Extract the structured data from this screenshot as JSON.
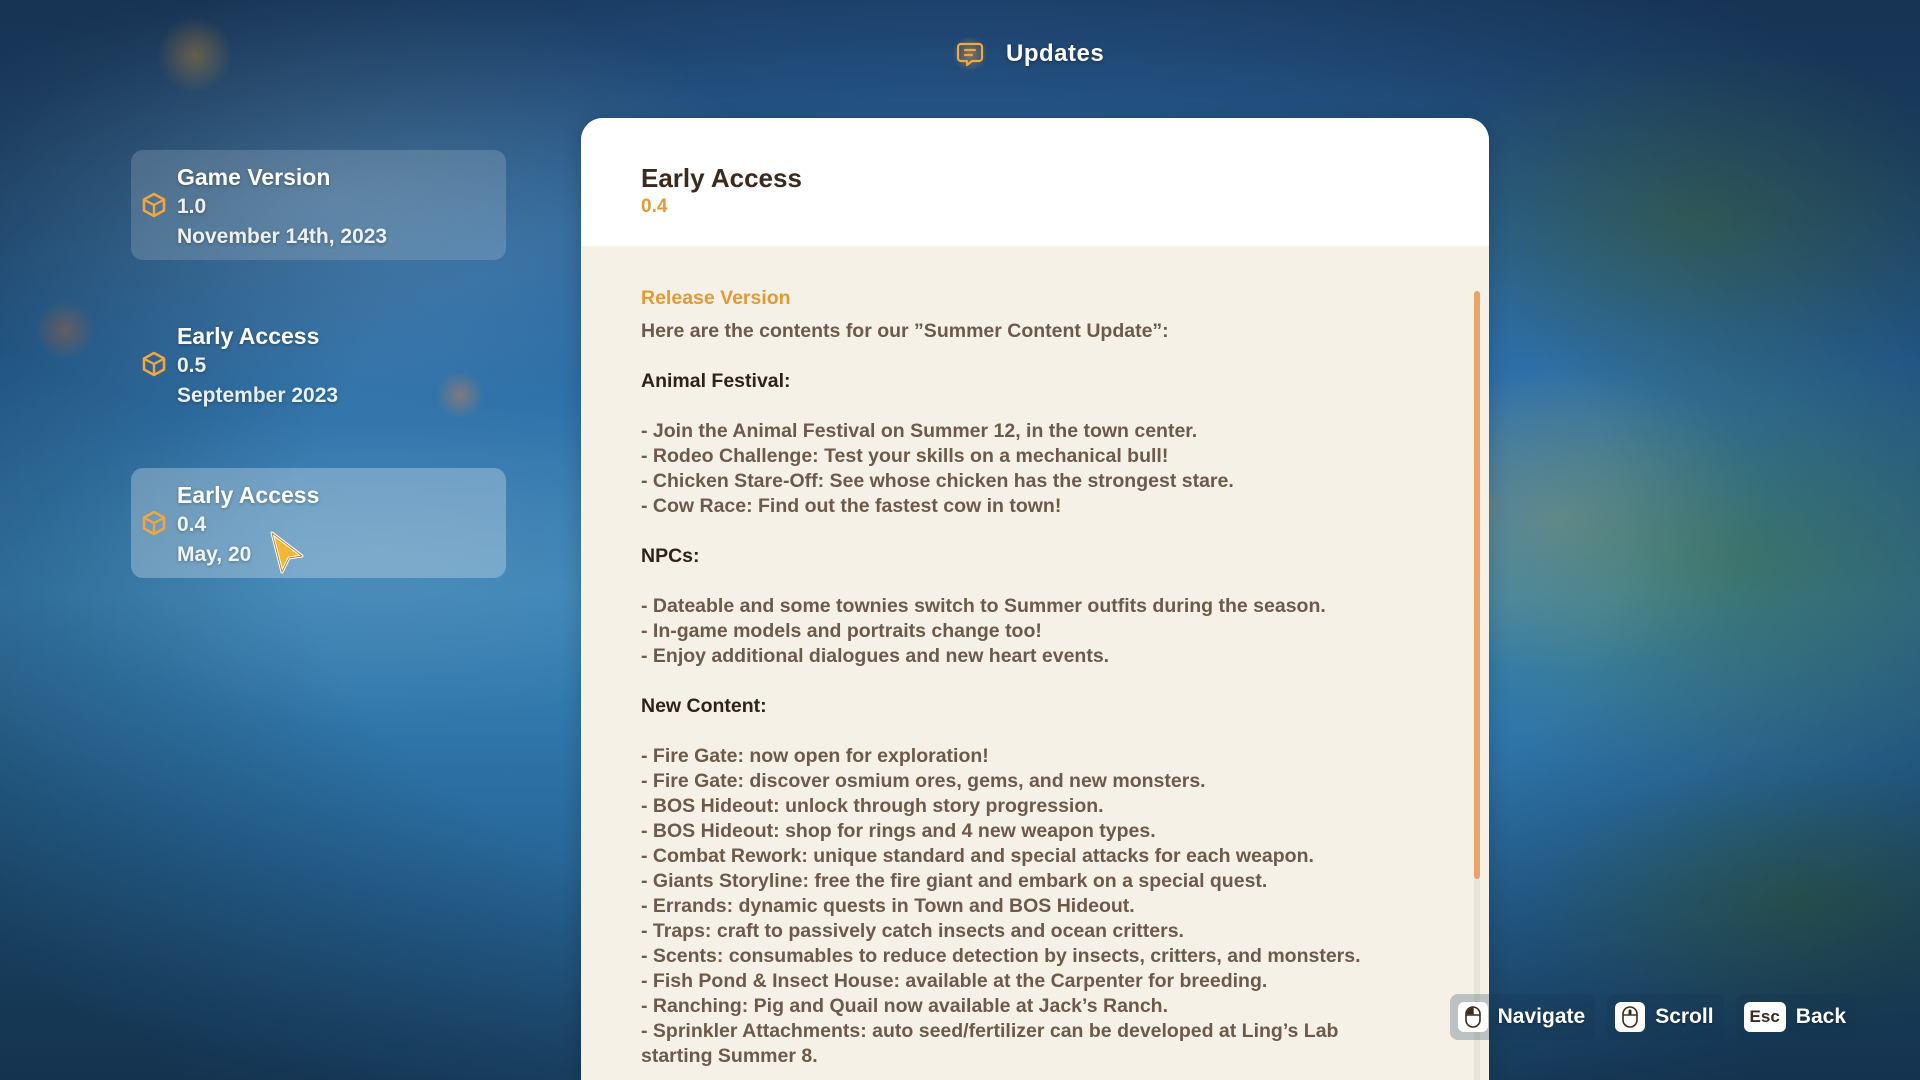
{
  "header": {
    "title": "Updates",
    "icon": "chat-bubble-icon"
  },
  "sidebar": {
    "items": [
      {
        "name": "Game Version",
        "version": "1.0",
        "date": "November 14th, 2023"
      },
      {
        "name": "Early Access",
        "version": "0.5",
        "date": "September 2023"
      },
      {
        "name": "Early Access",
        "version": "0.4",
        "date": "May, 20"
      }
    ],
    "selected_index": 2
  },
  "panel": {
    "title": "Early Access",
    "version": "0.4",
    "section_label": "Release Version",
    "intro": "Here are the contents for our ”Summer Content Update”:",
    "sections": [
      {
        "heading": "Animal Festival:",
        "items": [
          "- Join the Animal Festival on Summer 12, in the town center.",
          "- Rodeo Challenge: Test your skills on a mechanical bull!",
          "- Chicken Stare-Off: See whose chicken has the strongest stare.",
          "- Cow Race: Find out the fastest cow in town!"
        ]
      },
      {
        "heading": "NPCs:",
        "items": [
          "- Dateable and some townies switch to Summer outfits during the season.",
          "- In-game models and portraits change too!",
          "- Enjoy additional dialogues and new heart events."
        ]
      },
      {
        "heading": "New Content:",
        "items": [
          "- Fire Gate: now open for exploration!",
          "- Fire Gate: discover osmium ores, gems, and new monsters.",
          "- BOS Hideout: unlock through story progression.",
          "- BOS Hideout: shop for rings and 4 new weapon types.",
          "- Combat Rework: unique standard and special attacks for each weapon.",
          "- Giants Storyline: free the fire giant and embark on a special quest.",
          "- Errands: dynamic quests in Town and BOS Hideout.",
          "- Traps: craft to passively catch insects and ocean critters.",
          "- Scents: consumables to reduce detection by insects, critters, and monsters.",
          "- Fish Pond & Insect House: available at the Carpenter for breeding.",
          "- Ranching: Pig and Quail now available at Jack’s Ranch.",
          "- Sprinkler Attachments: auto seed/fertilizer can be developed at Ling’s Lab",
          "starting Summer 8."
        ]
      }
    ]
  },
  "hints": [
    {
      "key": "",
      "label": "Navigate",
      "icon": "mouse-icon"
    },
    {
      "key": "",
      "label": "Scroll",
      "icon": "mouse-wheel-icon"
    },
    {
      "key": "Esc",
      "label": "Back",
      "icon": "esc-key"
    }
  ],
  "colors": {
    "accent": "#e39a34",
    "heading": "#2e2219",
    "body_text": "#6d5a4a",
    "panel_bg": "#f5f1e7",
    "scroll_thumb": "#e8a46a"
  }
}
